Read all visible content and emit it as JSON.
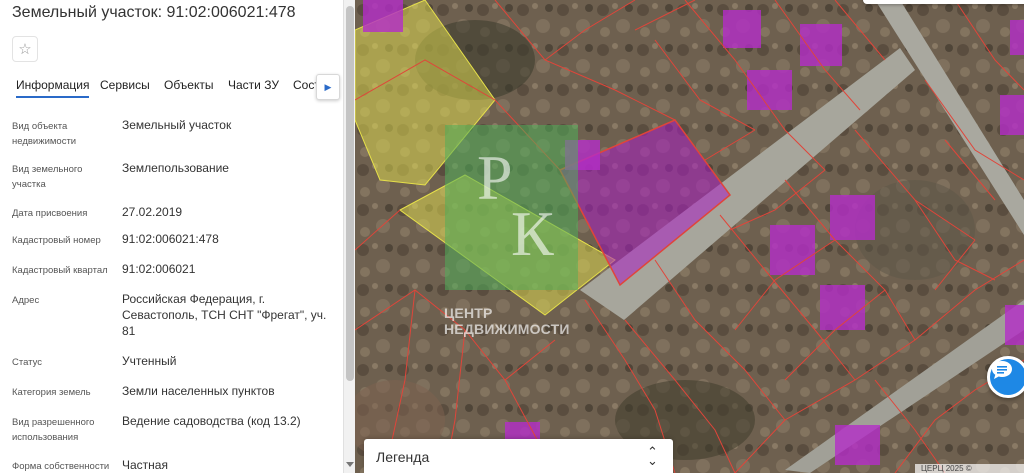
{
  "panel": {
    "title": "Земельный участок: 91:02:006021:478",
    "favorite_icon": "star-icon",
    "tabs": [
      {
        "label": "Информация",
        "active": true
      },
      {
        "label": "Сервисы"
      },
      {
        "label": "Объекты"
      },
      {
        "label": "Части ЗУ"
      },
      {
        "label": "Сост"
      }
    ],
    "tab_scroll_icon": "chevron-right-icon",
    "fields": [
      {
        "label": "Вид объекта недвижимости",
        "value": "Земельный участок"
      },
      {
        "label": "Вид земельного участка",
        "value": "Землепользование"
      },
      {
        "label": "Дата присвоения",
        "value": "27.02.2019"
      },
      {
        "label": "Кадастровый номер",
        "value": "91:02:006021:478"
      },
      {
        "label": "Кадастровый квартал",
        "value": "91:02:006021"
      },
      {
        "label": "Адрес",
        "value": "Российская Федерация, г. Севастополь, ТСН СНТ \"Фрегат\", уч. 81"
      },
      {
        "label": "Статус",
        "value": "Учтенный"
      },
      {
        "label": "Категория земель",
        "value": "Земли населенных пунктов"
      },
      {
        "label": "Вид разрешенного использования",
        "value": "Ведение садоводства (код 13.2)"
      },
      {
        "label": "Форма собственности",
        "value": "Частная"
      }
    ]
  },
  "map": {
    "watermark": {
      "letters_top": "Р",
      "letters_bottom": "К",
      "line1": "ЦЕНТР",
      "line2": "НЕДВИЖИМОСТИ"
    },
    "legend": {
      "label": "Легенда",
      "icon": "chevron-up-down-icon"
    },
    "chat_icon": "chat-icon",
    "attribution": "ЦЕРЦ 2025 ©",
    "colors": {
      "parcel_border": "#e0453a",
      "building": "#b030c0",
      "selected_parcel": "#a020c0",
      "highlight": "#e6e04a",
      "road": "#a3a29a",
      "accent": "#1e88e5"
    }
  }
}
